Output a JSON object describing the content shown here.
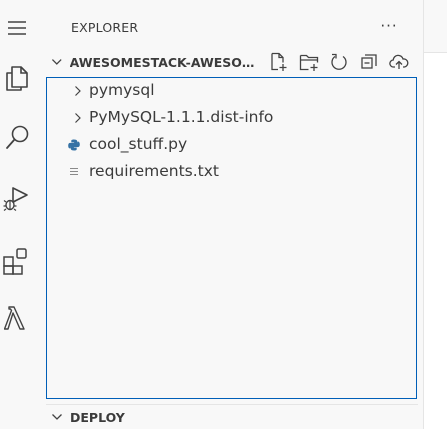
{
  "sidebar": {
    "title": "EXPLORER",
    "more_actions_label": "···",
    "folder_section": {
      "title": "AWESOMESTACK-AWESOM...",
      "actions": [
        {
          "name": "new-file",
          "icon": "new-file-icon"
        },
        {
          "name": "new-folder",
          "icon": "new-folder-icon"
        },
        {
          "name": "refresh",
          "icon": "refresh-icon"
        },
        {
          "name": "collapse-all",
          "icon": "collapse-all-icon"
        },
        {
          "name": "upload",
          "icon": "cloud-upload-icon"
        }
      ],
      "items": [
        {
          "label": "pymysql",
          "kind": "folder"
        },
        {
          "label": "PyMySQL-1.1.1.dist-info",
          "kind": "folder"
        },
        {
          "label": "cool_stuff.py",
          "kind": "python-file"
        },
        {
          "label": "requirements.txt",
          "kind": "text-file"
        }
      ]
    },
    "deploy_section": {
      "title": "DEPLOY"
    }
  },
  "activity_bar": [
    {
      "name": "menu-icon"
    },
    {
      "name": "explorer-icon"
    },
    {
      "name": "search-icon"
    },
    {
      "name": "run-debug-icon"
    },
    {
      "name": "extensions-icon"
    },
    {
      "name": "lambda-icon"
    }
  ],
  "colors": {
    "accent": "#005fb8",
    "python": "#3572a5"
  }
}
